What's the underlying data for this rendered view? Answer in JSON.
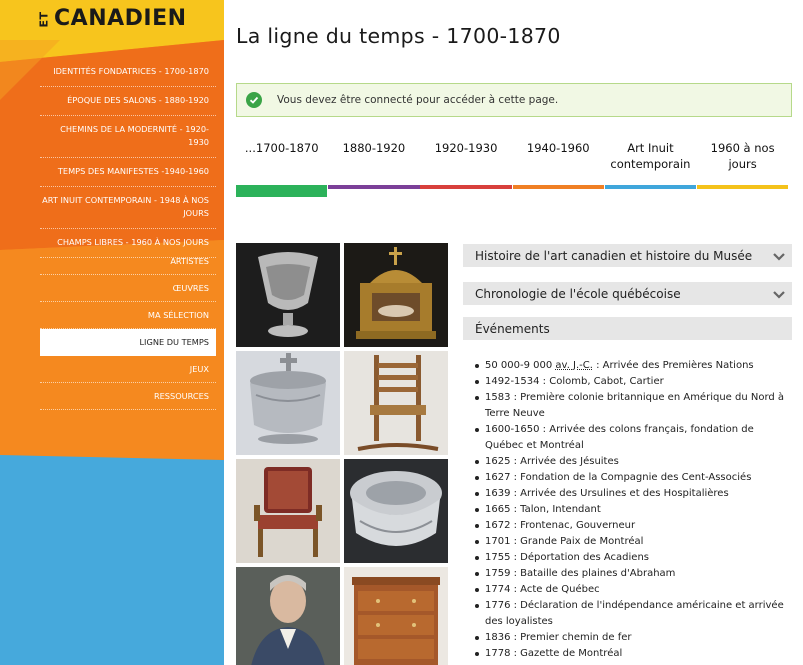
{
  "logo": {
    "prefix": "ET",
    "text": "CANADIEN"
  },
  "sidebar": {
    "periods": [
      {
        "label": "IDENTITÉS FONDATRICES - 1700-1870"
      },
      {
        "label": "ÉPOQUE DES SALONS - 1880-1920"
      },
      {
        "label": "CHEMINS DE LA MODERNITÉ - 1920-1930"
      },
      {
        "label": "TEMPS DES MANIFESTES -1940-1960"
      },
      {
        "label": "ART INUIT CONTEMPORAIN - 1948 À NOS JOURS"
      },
      {
        "label": "CHAMPS LIBRES - 1960 À NOS JOURS"
      }
    ],
    "menu": [
      {
        "label": "ARTISTES"
      },
      {
        "label": "ŒUVRES"
      },
      {
        "label": "MA SÉLECTION"
      },
      {
        "label": "LIGNE DU TEMPS"
      },
      {
        "label": "JEUX"
      },
      {
        "label": "RESSOURCES"
      }
    ],
    "active_menu": "LIGNE DU TEMPS"
  },
  "page": {
    "title": "La ligne du temps - 1700-1870"
  },
  "notice": {
    "message": "Vous devez être connecté pour accéder à cette page."
  },
  "timeline_tabs": [
    {
      "label": "...1700-1870",
      "color": "#2cb25a",
      "active": true
    },
    {
      "label": "1880-1920",
      "color": "#7b3f98"
    },
    {
      "label": "1920-1930",
      "color": "#d8403c"
    },
    {
      "label": "1940-1960",
      "color": "#f07f24"
    },
    {
      "label": "Art Inuit contemporain",
      "color": "#3fa6db"
    },
    {
      "label": "1960 à nos jours",
      "color": "#f4c21a"
    }
  ],
  "thumbnails": [
    {
      "name": "silver-cup"
    },
    {
      "name": "gilded-reliquary"
    },
    {
      "name": "covered-pewter-bowl"
    },
    {
      "name": "ladder-back-rocking-chair"
    },
    {
      "name": "upholstered-armchair"
    },
    {
      "name": "silver-tureen"
    },
    {
      "name": "portrait-man"
    },
    {
      "name": "commode-dresser"
    }
  ],
  "accordions": [
    {
      "title": "Histoire de l'art canadien et histoire du Musée"
    },
    {
      "title": "Chronologie de l'école québécoise"
    }
  ],
  "events": {
    "title": "Événements",
    "first": {
      "abbr": "av. J.-C.",
      "prefix": "50 000-9 000",
      "rest": " : Arrivée des Premières Nations"
    },
    "items": [
      "1492-1534 : Colomb, Cabot, Cartier",
      "1583 : Première colonie britannique en Amérique du Nord à Terre Neuve",
      "1600-1650 : Arrivée des colons français, fondation de Québec et Montréal",
      "1625 : Arrivée des Jésuites",
      "1627 : Fondation de la Compagnie des Cent-Associés",
      "1639 : Arrivée des Ursulines et des Hospitalières",
      "1665 : Talon, Intendant",
      "1672 : Frontenac, Gouverneur",
      "1701 : Grande Paix de Montréal",
      "1755 : Déportation des Acadiens",
      "1759 : Bataille des plaines d'Abraham",
      "1774 : Acte de Québec",
      "1776 : Déclaration de l'indépendance américaine et arrivée des loyalistes",
      "1836 : Premier chemin de fer",
      "1778 : Gazette de Montréal"
    ]
  }
}
